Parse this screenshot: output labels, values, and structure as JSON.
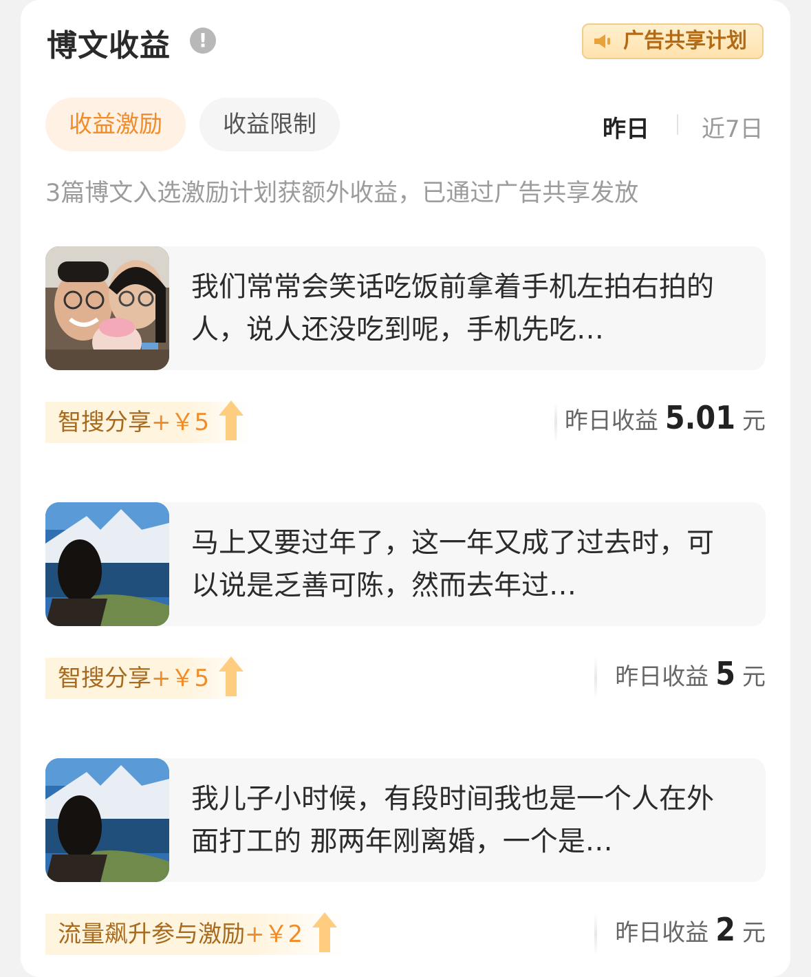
{
  "header": {
    "title": "博文收益",
    "info_icon": "!",
    "ad_plan_label": "广告共享计划"
  },
  "tabs": [
    {
      "label": "收益激励",
      "active": true
    },
    {
      "label": "收益限制",
      "active": false
    }
  ],
  "range": {
    "yesterday": "昨日",
    "last7": "近7日"
  },
  "summary": "3篇博文入选激励计划获额外收益，已通过广告共享发放",
  "posts": [
    {
      "text": "我们常常会笑话吃饭前拿着手机左拍右拍的人，说人还没吃到呢，手机先吃…",
      "reward_name": "智搜分享",
      "reward_amount": "+￥5",
      "earn_label": "昨日收益",
      "earn_value": "5.01",
      "earn_unit": "元",
      "thumb": "family-selfie"
    },
    {
      "text": "马上又要过年了，这一年又成了过去时，可以说是乏善可陈，然而去年过…",
      "reward_name": "智搜分享",
      "reward_amount": "+￥5",
      "earn_label": "昨日收益",
      "earn_value": "5",
      "earn_unit": "元",
      "thumb": "white-temple"
    },
    {
      "text": "我儿子小时候，有段时间我也是一个人在外面打工的 那两年刚离婚，一个是…",
      "reward_name": "流量飙升参与激励",
      "reward_amount": "+￥2",
      "earn_label": "昨日收益",
      "earn_value": "2",
      "earn_unit": "元",
      "thumb": "white-temple"
    }
  ],
  "colors": {
    "accent": "#f08c2a",
    "brown": "#a86a1c",
    "background": "#ffffff"
  }
}
